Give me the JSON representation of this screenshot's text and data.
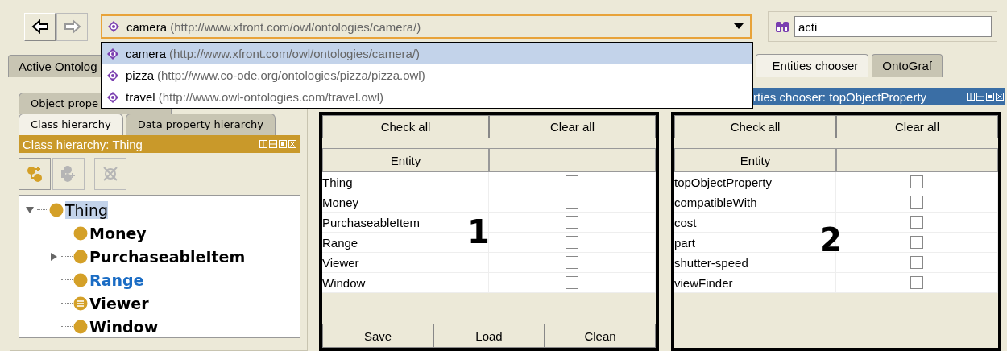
{
  "toolbar": {
    "nav_buttons": [
      {
        "kind": "back",
        "disabled": false
      },
      {
        "kind": "forward",
        "disabled": true
      }
    ],
    "ontology_combo": {
      "name": "camera",
      "uri": "(http://www.xfront.com/owl/ontologies/camera/)"
    },
    "search": {
      "value": "acti"
    }
  },
  "ontology_dropdown": [
    {
      "name": "camera",
      "uri": "(http://www.xfront.com/owl/ontologies/camera/)",
      "selected": true
    },
    {
      "name": "pizza",
      "uri": "(http://www.co-ode.org/ontologies/pizza/pizza.owl)",
      "selected": false
    },
    {
      "name": "travel",
      "uri": "(http://www.owl-ontologies.com/travel.owl)",
      "selected": false
    }
  ],
  "main_tabs_left": [
    {
      "label": "Active Ontolog",
      "selected": false
    }
  ],
  "main_tabs_right": [
    {
      "label": "Entities chooser",
      "selected": true
    },
    {
      "label": "OntoGraf",
      "selected": false
    }
  ],
  "left_panel": {
    "back_tabs": [
      {
        "label": "Object prope",
        "selected": false
      }
    ],
    "tabs": [
      {
        "label": "Class hierarchy",
        "selected": true
      },
      {
        "label": "Data property hierarchy",
        "selected": false
      }
    ],
    "header": "Class hierarchy: Thing",
    "tools": [
      {
        "kind": "add-subclass",
        "disabled": false
      },
      {
        "kind": "add-sibling",
        "disabled": true
      },
      {
        "kind": "delete",
        "disabled": true
      }
    ],
    "tree": [
      {
        "label": "Thing",
        "kind": "primitive",
        "bold": false,
        "selected": true,
        "expanded": true,
        "color": "#000000",
        "children": [
          {
            "label": "Money",
            "kind": "primitive",
            "bold": true,
            "selected": false,
            "color": "#000000"
          },
          {
            "label": "PurchaseableItem",
            "kind": "primitive",
            "bold": true,
            "selected": false,
            "expanded": false,
            "color": "#000000"
          },
          {
            "label": "Range",
            "kind": "primitive",
            "bold": true,
            "selected": false,
            "color": "#1a6cc4"
          },
          {
            "label": "Viewer",
            "kind": "defined",
            "bold": true,
            "selected": false,
            "color": "#000000"
          },
          {
            "label": "Window",
            "kind": "primitive",
            "bold": true,
            "selected": false,
            "color": "#000000"
          }
        ]
      }
    ]
  },
  "right_header": "rties chooser: topObjectProperty",
  "panels": [
    {
      "buttons": [
        "Check all",
        "Clear all"
      ],
      "column": "Entity",
      "annotation": "1",
      "rows": [
        {
          "entity": "Thing",
          "checked": false
        },
        {
          "entity": "Money",
          "checked": false
        },
        {
          "entity": "PurchaseableItem",
          "checked": false
        },
        {
          "entity": "Range",
          "checked": false
        },
        {
          "entity": "Viewer",
          "checked": false
        },
        {
          "entity": "Window",
          "checked": false
        }
      ],
      "bottom_buttons": [
        "Save",
        "Load",
        "Clean"
      ]
    },
    {
      "buttons": [
        "Check all",
        "Clear all"
      ],
      "column": "Entity",
      "annotation": "2",
      "rows": [
        {
          "entity": "topObjectProperty",
          "checked": false
        },
        {
          "entity": "compatibleWith",
          "checked": false
        },
        {
          "entity": "cost",
          "checked": false
        },
        {
          "entity": "part",
          "checked": false
        },
        {
          "entity": "shutter-speed",
          "checked": false
        },
        {
          "entity": "viewFinder",
          "checked": false
        }
      ]
    }
  ]
}
